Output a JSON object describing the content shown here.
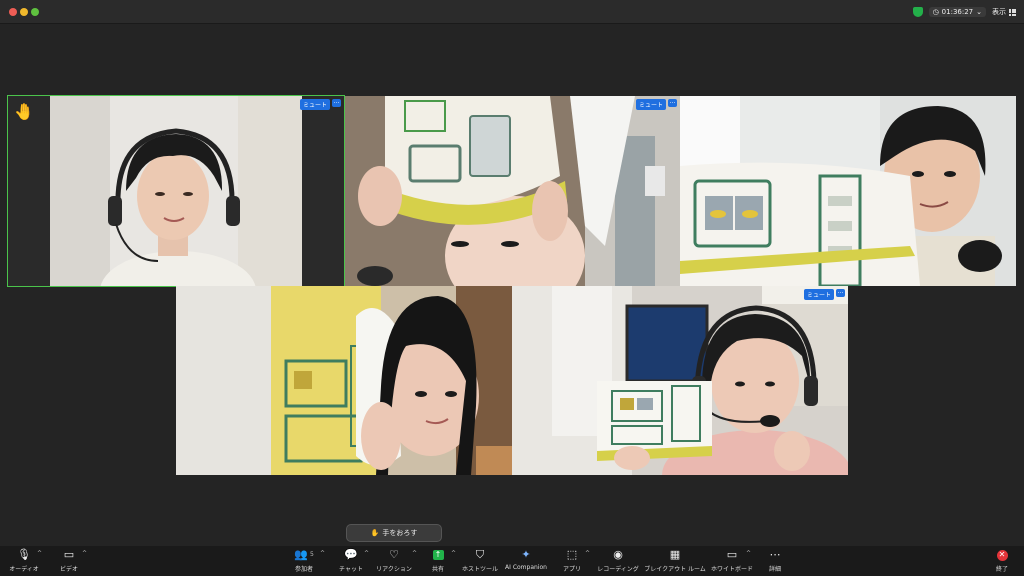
{
  "titlebar": {
    "timer": "01:36:27",
    "view_label": "表示"
  },
  "tiles": [
    {
      "id": "tile-1",
      "badge": "ミュート",
      "more": "…",
      "hand": "🤚"
    },
    {
      "id": "tile-2",
      "badge": "ミュート",
      "more": "…"
    },
    {
      "id": "tile-3"
    },
    {
      "id": "tile-4"
    },
    {
      "id": "tile-5",
      "badge": "ミュート",
      "more": "…"
    }
  ],
  "raise_hand": {
    "icon": "✋",
    "label": "手をおろす"
  },
  "toolbar": {
    "audio": "オーディオ",
    "video": "ビデオ",
    "participants": "参加者",
    "participants_count": "5",
    "chat": "チャット",
    "reactions": "リアクション",
    "share": "共有",
    "host_tools": "ホストツール",
    "ai_companion": "AI Companion",
    "apps": "アプリ",
    "recording": "レコーディング",
    "breakout": "ブレイクアウト ルーム",
    "whiteboard": "ホワイトボード",
    "more": "詳細",
    "end": "終了"
  },
  "colors": {
    "accent_blue": "#1f6fe0",
    "active_border": "#4bc44b",
    "share_green": "#21b34a",
    "end_red": "#e3343a"
  }
}
